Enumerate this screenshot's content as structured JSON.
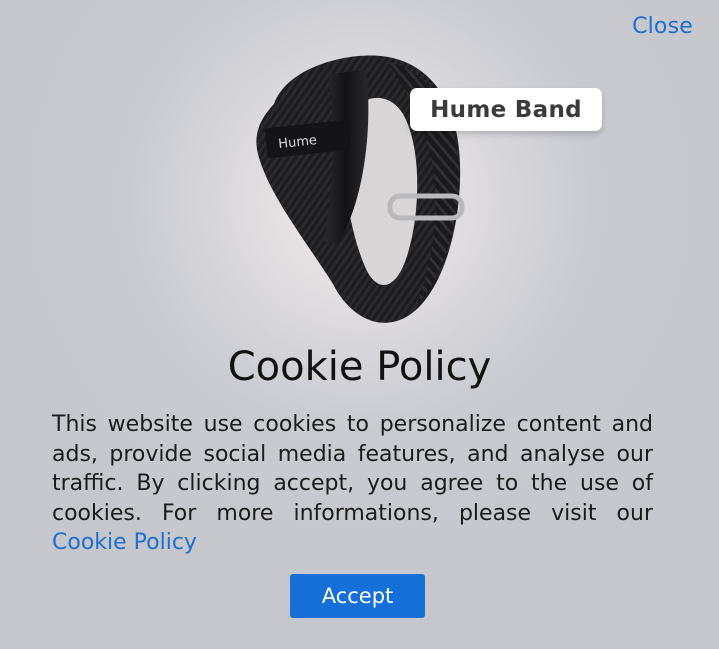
{
  "dialog": {
    "close_label": "Close",
    "title": "Cookie Policy",
    "body_text": "This website use cookies to personalize content and ads, provide social media features, and analyse our traffic. By clicking accept, you agree to the use of cookies. For more informations, please visit our ",
    "policy_link_label": "Cookie Policy",
    "accept_label": "Accept"
  },
  "hero": {
    "product_tag": "Hume Band",
    "band_logo_text": "Hume",
    "band_color": "#1f1f21"
  },
  "colors": {
    "link": "#1e6fd0",
    "accept_button": "#1470d8",
    "background": "#c9cbd1"
  }
}
